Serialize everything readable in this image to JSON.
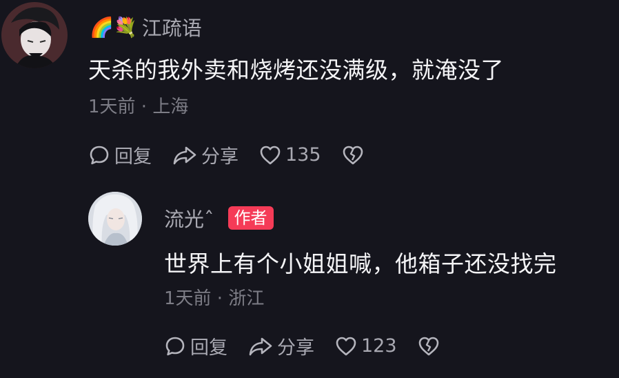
{
  "comments": [
    {
      "username_emoji": "🌈💐",
      "username": "江疏语",
      "text": "天杀的我外卖和烧烤还没满级，就淹没了",
      "meta": "1天前 · 上海",
      "reply_label": "回复",
      "share_label": "分享",
      "like_count": "135"
    },
    {
      "username": "流光ˆ",
      "author_badge": "作者",
      "text": "世界上有个小姐姐喊，他箱子还没找完",
      "meta": "1天前 · 浙江",
      "reply_label": "回复",
      "share_label": "分享",
      "like_count": "123"
    }
  ],
  "icons": {
    "reply": "reply-bubble-icon",
    "share": "share-arrow-icon",
    "like": "heart-icon",
    "dislike": "broken-heart-icon"
  },
  "colors": {
    "background": "#15151d",
    "author_badge": "#f53b57",
    "secondary_text": "#a9a9b2",
    "meta_text": "#7d7d86"
  }
}
